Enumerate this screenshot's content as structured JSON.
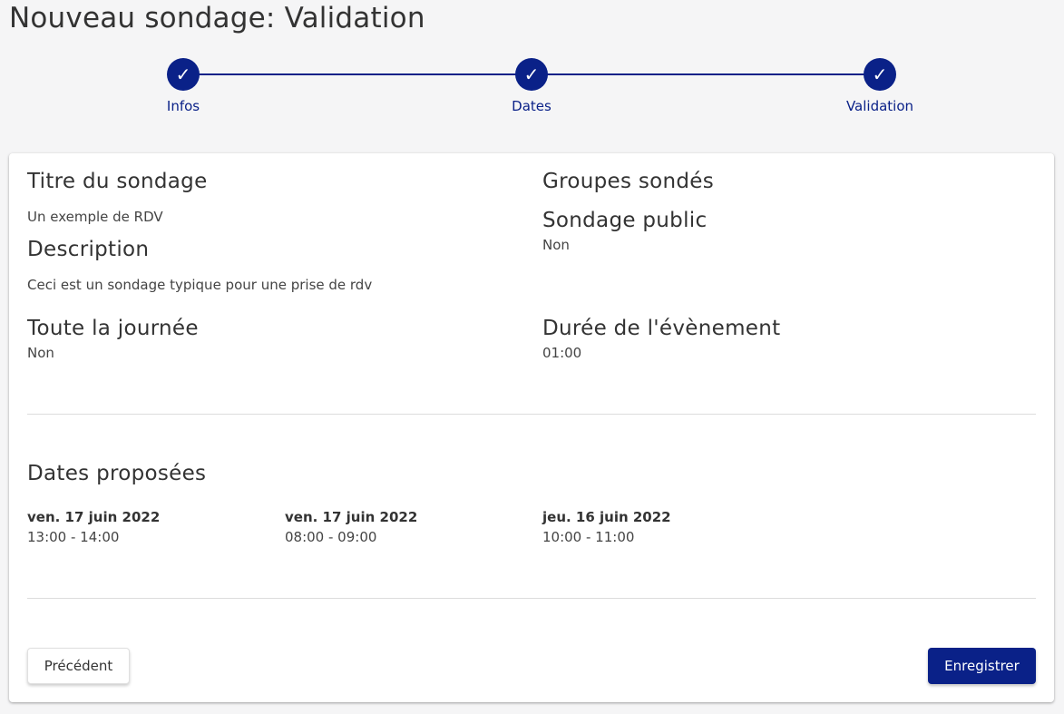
{
  "page": {
    "title": "Nouveau sondage: Validation"
  },
  "stepper": {
    "steps": [
      {
        "label": "Infos",
        "icon": "check-icon",
        "glyph": "✓",
        "completed": true
      },
      {
        "label": "Dates",
        "icon": "check-icon",
        "glyph": "✓",
        "completed": true
      },
      {
        "label": "Validation",
        "icon": "check-icon",
        "glyph": "✓",
        "completed": true
      }
    ]
  },
  "summary": {
    "poll_title": {
      "heading": "Titre du sondage",
      "value": "Un exemple de RDV"
    },
    "description": {
      "heading": "Description",
      "value": "Ceci est un sondage typique pour une prise de rdv"
    },
    "groups": {
      "heading": "Groupes sondés",
      "value": ""
    },
    "public": {
      "heading": "Sondage public",
      "value": "Non"
    },
    "all_day": {
      "heading": "Toute la journée",
      "value": "Non"
    },
    "duration": {
      "heading": "Durée de l'évènement",
      "value": "01:00"
    }
  },
  "dates": {
    "heading": "Dates proposées",
    "items": [
      {
        "day": "ven. 17 juin 2022",
        "time": "13:00 - 14:00"
      },
      {
        "day": "ven. 17 juin 2022",
        "time": "08:00 - 09:00"
      },
      {
        "day": "jeu. 16 juin 2022",
        "time": "10:00 - 11:00"
      }
    ]
  },
  "actions": {
    "previous_label": "Précédent",
    "save_label": "Enregistrer"
  },
  "colors": {
    "accent": "#0a2188",
    "background": "#f5f5f6",
    "card": "#ffffff"
  }
}
